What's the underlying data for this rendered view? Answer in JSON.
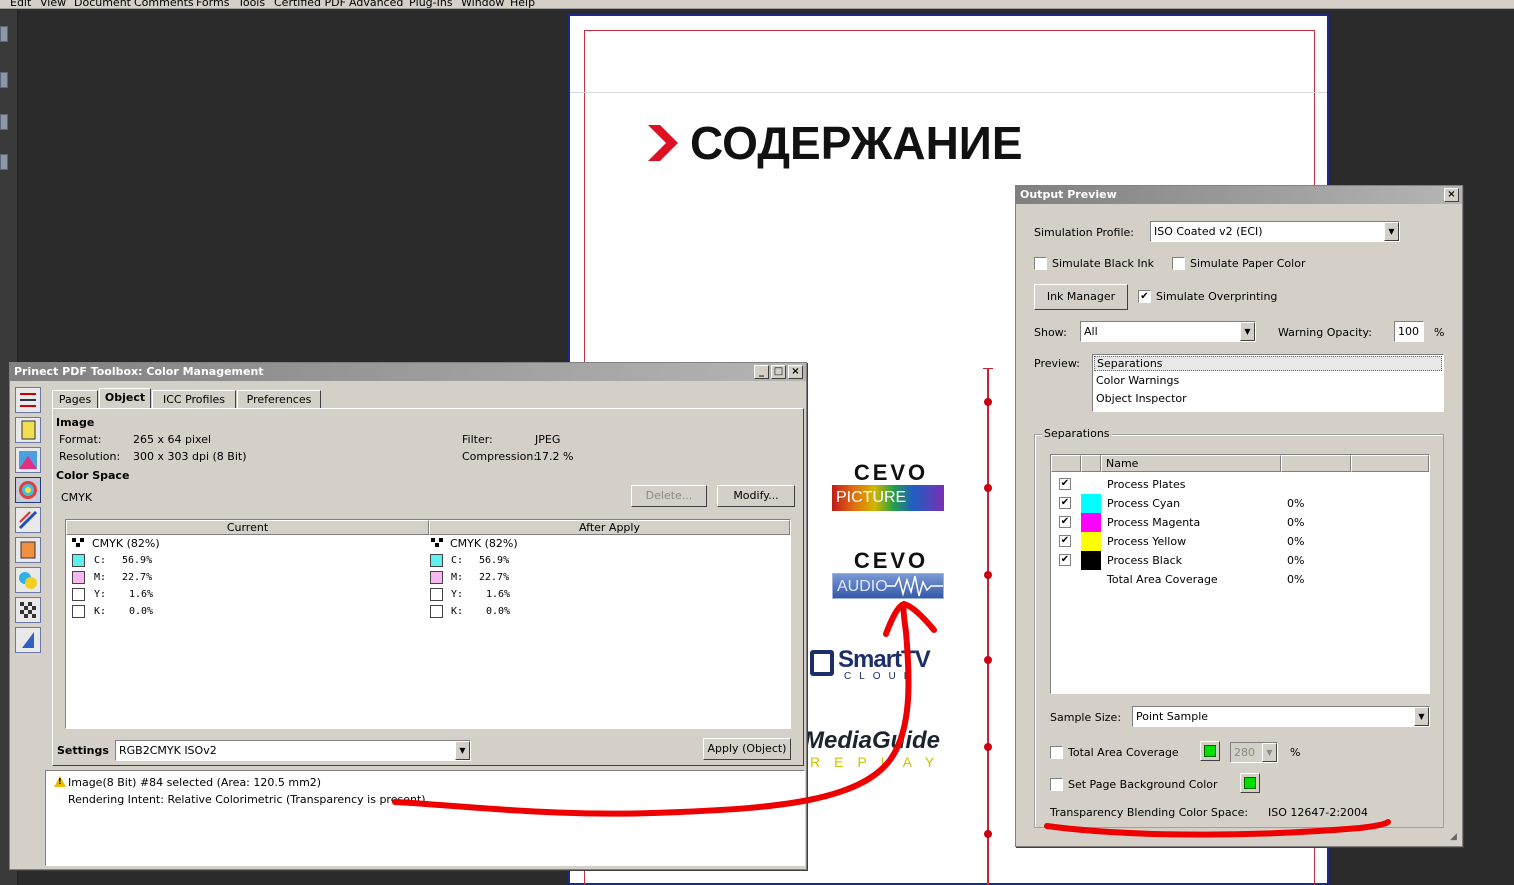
{
  "menu": [
    "Edit",
    "View",
    "Document",
    "Comments",
    "Forms",
    "Tools",
    "Certified PDF",
    "Advanced",
    "Plug-Ins",
    "Window",
    "Help"
  ],
  "page": {
    "heading": "СОДЕРЖАНИЕ",
    "logos": {
      "cevo_picture_word": "CEVO",
      "cevo_picture_bar": "PICTURE",
      "cevo_audio_word": "CEVO",
      "cevo_audio_bar": "AUDIO",
      "smarttv_big": "SmartTV",
      "smarttv_small": "CLOUD",
      "mediaguide_big": "MediaGuide",
      "mediaguide_small": "REPLAY"
    }
  },
  "color_management": {
    "title": "Prinect PDF Toolbox: Color Management",
    "tabs": [
      "Pages",
      "Object",
      "ICC Profiles",
      "Preferences"
    ],
    "active_tab": "Object",
    "image_header": "Image",
    "format_label": "Format:",
    "format_value": "265 x 64 pixel",
    "resolution_label": "Resolution:",
    "resolution_value": "300 x 303 dpi (8 Bit)",
    "filter_label": "Filter:",
    "filter_value": "JPEG",
    "compression_label": "Compression:",
    "compression_value": "17.2 %",
    "colorspace_header": "Color Space",
    "colorspace_value": "CMYK",
    "delete_button": "Delete...",
    "modify_button": "Modify...",
    "table": {
      "current_header": "Current",
      "after_header": "After Apply",
      "current_space": "CMYK (82%)",
      "after_space": "CMYK (82%)",
      "rows": [
        {
          "label": "C:",
          "value": "56.9%",
          "color": "#5ff0f0"
        },
        {
          "label": "M:",
          "value": "22.7%",
          "color": "#f5b8f0"
        },
        {
          "label": "Y:",
          "value": "1.6%",
          "color": "#ffffff"
        },
        {
          "label": "K:",
          "value": "0.0%",
          "color": "#ffffff"
        }
      ]
    },
    "settings_label": "Settings",
    "settings_value": "RGB2CMYK ISOv2",
    "apply_button": "Apply (Object)",
    "message_line1": "Image(8 Bit) #84 selected  (Area: 120.5 mm2)",
    "message_line2": "Rendering Intent: Relative Colorimetric  (Transparency is present)"
  },
  "output_preview": {
    "title": "Output Preview",
    "simulation_profile_label": "Simulation Profile:",
    "simulation_profile_value": "ISO Coated v2 (ECI)",
    "simulate_black_ink": "Simulate Black Ink",
    "simulate_paper_color": "Simulate Paper Color",
    "ink_manager_button": "Ink Manager",
    "simulate_overprinting": "Simulate Overprinting",
    "show_label": "Show:",
    "show_value": "All",
    "warning_opacity_label": "Warning Opacity:",
    "warning_opacity_value": "100",
    "percent": "%",
    "preview_label": "Preview:",
    "preview_items": [
      "Separations",
      "Color Warnings",
      "Object Inspector"
    ],
    "separations_group": "Separations",
    "name_header": "Name",
    "separations": [
      {
        "name": "Process Plates",
        "checked": true,
        "color": "",
        "pct": ""
      },
      {
        "name": "Process Cyan",
        "checked": true,
        "color": "#00ffff",
        "pct": "0%"
      },
      {
        "name": "Process Magenta",
        "checked": true,
        "color": "#ff00ff",
        "pct": "0%"
      },
      {
        "name": "Process Yellow",
        "checked": true,
        "color": "#ffff00",
        "pct": "0%"
      },
      {
        "name": "Process Black",
        "checked": true,
        "color": "#000000",
        "pct": "0%"
      },
      {
        "name": "Total Area Coverage",
        "checked": false,
        "color": "",
        "pct": "0%"
      }
    ],
    "sample_size_label": "Sample Size:",
    "sample_size_value": "Point Sample",
    "total_area_coverage": "Total Area Coverage",
    "tac_value": "280",
    "set_page_background": "Set Page Background Color",
    "transparency_label": "Transparency Blending Color Space:",
    "transparency_value": "ISO 12647-2:2004"
  },
  "colors": {
    "annotation_red": "#ee0000",
    "swatch_green": "#00e000"
  }
}
